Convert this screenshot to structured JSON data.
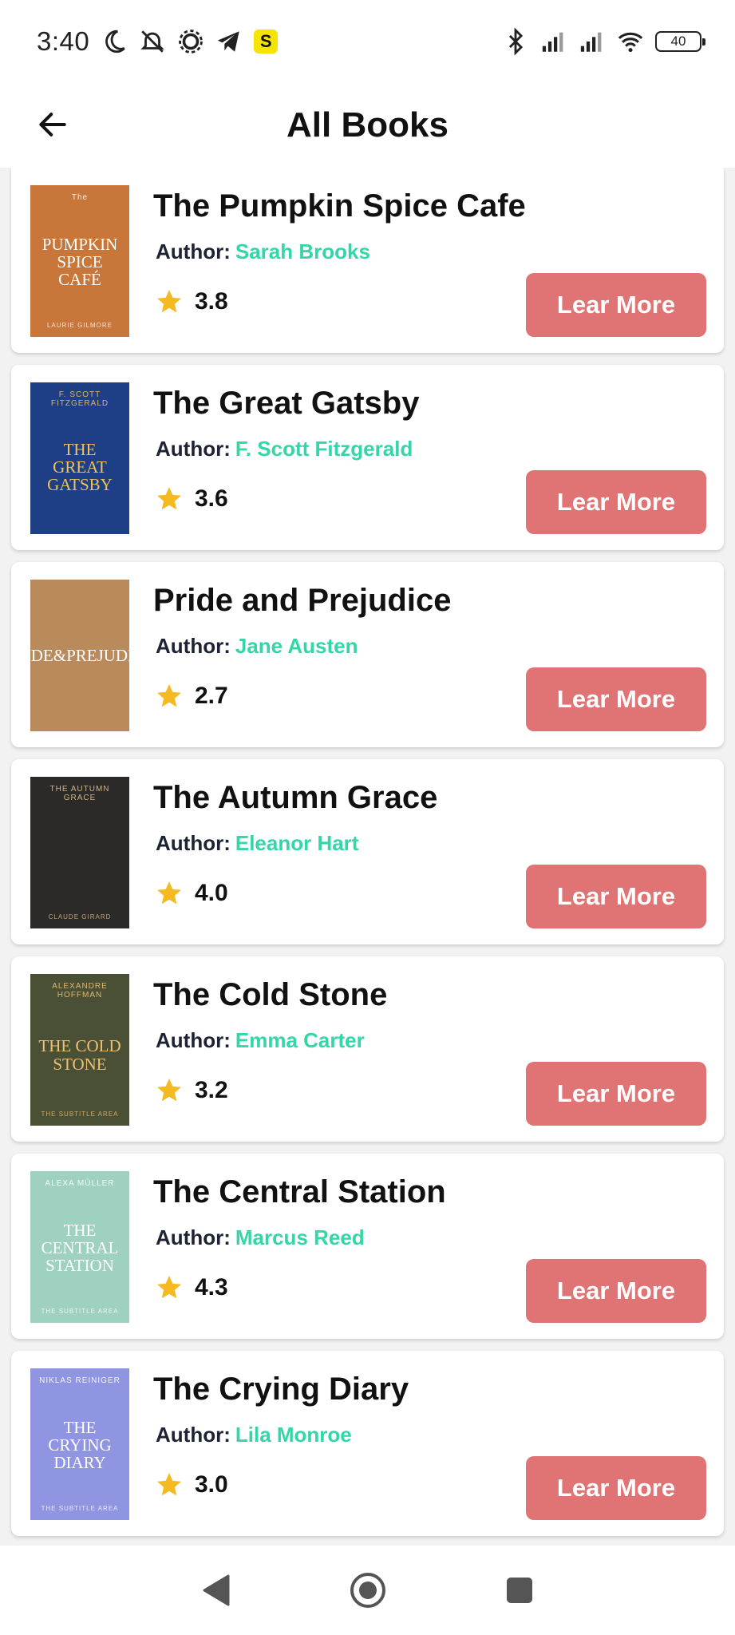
{
  "status_bar": {
    "time": "3:40",
    "battery": "40",
    "icons": [
      "moon-icon",
      "mute-icon",
      "settings-icon",
      "telegram-icon",
      "s-app-icon",
      "bluetooth-icon",
      "signal-icon",
      "signal-icon",
      "wifi-icon",
      "battery-icon"
    ],
    "s_badge": "S"
  },
  "header": {
    "title": "All Books",
    "back_icon": "arrow-left-icon"
  },
  "books": [
    {
      "title": "The Pumpkin Spice Cafe",
      "author_label": "Author:",
      "author": "Sarah Brooks",
      "rating": "3.8",
      "button_label": "Lear More",
      "cover": {
        "top": "The",
        "title": "PUMPKIN SPICE CAFÉ",
        "bottom": "LAURIE GILMORE",
        "bg": "#c9763a",
        "fg": "#ffffff"
      }
    },
    {
      "title": "The Great Gatsby",
      "author_label": "Author:",
      "author": "F. Scott Fitzgerald",
      "rating": "3.6",
      "button_label": "Lear More",
      "cover": {
        "top": "F. SCOTT FITZGERALD",
        "title": "THE GREAT GATSBY",
        "bottom": "",
        "bg": "#1e3f86",
        "fg": "#f1c25a"
      }
    },
    {
      "title": "Pride and Prejudice",
      "author_label": "Author:",
      "author": "Jane Austen",
      "rating": "2.7",
      "button_label": "Lear More",
      "cover": {
        "top": "",
        "title": "PRIDE&PREJUDICE",
        "bottom": "",
        "bg": "#b98a5c",
        "fg": "#ffffff"
      }
    },
    {
      "title": "The Autumn Grace",
      "author_label": "Author:",
      "author": "Eleanor Hart",
      "rating": "4.0",
      "button_label": "Lear More",
      "cover": {
        "top": "THE AUTUMN GRACE",
        "title": "",
        "bottom": "CLAUDE GIRARD",
        "bg": "#2c2a28",
        "fg": "#e2c08a"
      }
    },
    {
      "title": "The Cold Stone",
      "author_label": "Author:",
      "author": "Emma Carter",
      "rating": "3.2",
      "button_label": "Lear More",
      "cover": {
        "top": "ALEXANDRE HOFFMAN",
        "title": "THE COLD STONE",
        "bottom": "THE SUBTITLE AREA",
        "bg": "#4a5036",
        "fg": "#f0c070"
      }
    },
    {
      "title": "The Central Station",
      "author_label": "Author:",
      "author": "Marcus Reed",
      "rating": "4.3",
      "button_label": "Lear More",
      "cover": {
        "top": "ALEXA MÜLLER",
        "title": "THE CENTRAL STATION",
        "bottom": "THE SUBTITLE AREA",
        "bg": "#9fd1c0",
        "fg": "#ffffff"
      }
    },
    {
      "title": "The Crying Diary",
      "author_label": "Author:",
      "author": "Lila Monroe",
      "rating": "3.0",
      "button_label": "Lear More",
      "cover": {
        "top": "NIKLAS REINIGER",
        "title": "THE CRYING DIARY",
        "bottom": "THE SUBTITLE AREA",
        "bg": "#8f95e0",
        "fg": "#ffffff"
      }
    }
  ],
  "nav_bar": {
    "icons": [
      "back-triangle-icon",
      "home-circle-icon",
      "recents-square-icon"
    ]
  },
  "colors": {
    "accent_button": "#e07474",
    "author_name": "#33d6a8",
    "star": "#f5b921"
  }
}
